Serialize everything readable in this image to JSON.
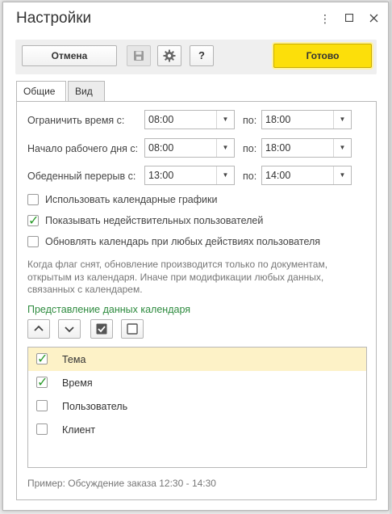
{
  "window": {
    "title": "Настройки",
    "controls": {
      "menu": "⋮",
      "maximize": "☐",
      "close": "✕"
    }
  },
  "toolbar": {
    "cancel_label": "Отмена",
    "help_label": "?",
    "done_label": "Готово"
  },
  "tabs": [
    {
      "label": "Общие",
      "active": true
    },
    {
      "label": "Вид",
      "active": false
    }
  ],
  "time": {
    "rows": [
      {
        "label": "Ограничить время с:",
        "from": "08:00",
        "to_label": "по:",
        "to": "18:00"
      },
      {
        "label": "Начало рабочего дня с:",
        "from": "08:00",
        "to_label": "по:",
        "to": "18:00"
      },
      {
        "label": "Обеденный перерыв с:",
        "from": "13:00",
        "to_label": "по:",
        "to": "14:00"
      }
    ]
  },
  "options": [
    {
      "label": "Использовать календарные графики",
      "checked": false
    },
    {
      "label": "Показывать недействительных пользователей",
      "checked": true
    },
    {
      "label": "Обновлять календарь при любых действиях пользователя",
      "checked": false
    }
  ],
  "hint": "Когда флаг снят, обновление производится только по документам, открытым из календаря. Иначе при модификации любых данных, связанных с календарем.",
  "calendar_view": {
    "title": "Представление данных календаря",
    "items": [
      {
        "label": "Тема",
        "checked": true,
        "selected": true
      },
      {
        "label": "Время",
        "checked": true,
        "selected": false
      },
      {
        "label": "Пользователь",
        "checked": false,
        "selected": false
      },
      {
        "label": "Клиент",
        "checked": false,
        "selected": false
      }
    ]
  },
  "example": "Пример: Обсуждение заказа 12:30 - 14:30",
  "colors": {
    "accent_yellow": "#fcdf0a",
    "section_green": "#2e8b3f",
    "check_green": "#2a9b2a",
    "selected_row": "#fdf2c7"
  }
}
